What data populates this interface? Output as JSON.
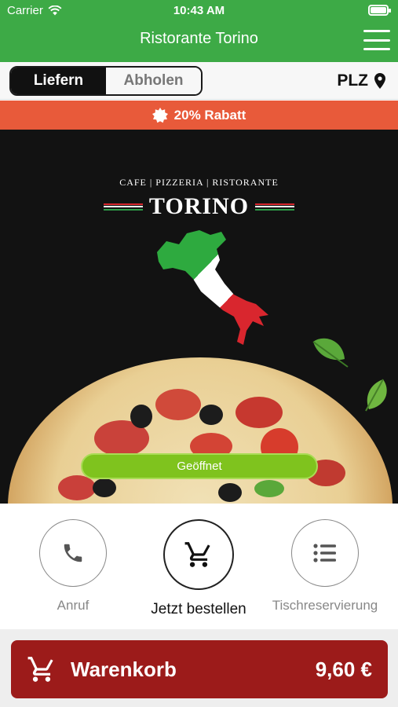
{
  "status_bar": {
    "carrier": "Carrier",
    "time": "10:43 AM"
  },
  "header": {
    "title": "Ristorante Torino"
  },
  "mode_toggle": {
    "options": [
      "Liefern",
      "Abholen"
    ],
    "selected": "Liefern"
  },
  "location": {
    "label": "PLZ"
  },
  "promo": {
    "text": "20% Rabatt"
  },
  "hero": {
    "brand_tagline": "CAFE | PIZZERIA | RISTORANTE",
    "brand_name": "TORINO",
    "open_status": "Geöffnet"
  },
  "actions": [
    {
      "label": "Anruf",
      "icon": "phone-icon"
    },
    {
      "label": "Jetzt bestellen",
      "icon": "cart-icon"
    },
    {
      "label": "Tischreservierung",
      "icon": "list-icon"
    }
  ],
  "cart": {
    "label": "Warenkorb",
    "total": "9,60 €"
  },
  "colors": {
    "header_green": "#3daa46",
    "promo_orange": "#e85a3a",
    "cart_red": "#9c1b1a",
    "open_green": "#7fc31e"
  }
}
